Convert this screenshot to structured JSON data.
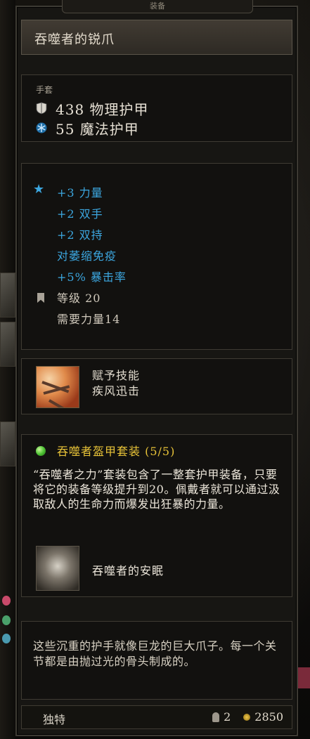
{
  "header": {
    "tab_label": "装备"
  },
  "item": {
    "name": "吞噬者的锐爪",
    "slot_type": "手套",
    "physical_armor": "438 物理护甲",
    "magic_armor": "55 魔法护甲"
  },
  "bonuses": {
    "lines": [
      "+3 力量",
      "+2 双手",
      "+2 双持",
      "对萎缩免疫",
      "+5% 暴击率"
    ],
    "level": "等级 20",
    "requirement": "需要力量14"
  },
  "skill": {
    "label": "赋予技能",
    "name": "疾风迅击"
  },
  "set": {
    "title": "吞噬者盔甲套装 (5/5)",
    "description": "“吞噬者之力”套装包含了一整套护甲装备，只要将它的装备等级提升到20。佩戴者就可以通过汲取敌人的生命力而爆发出狂暴的力量。",
    "item_name": "吞噬者的安眠"
  },
  "flavor_text": "这些沉重的护手就像巨龙的巨大爪子。每一个关节都是由抛过光的骨头制成的。",
  "footer": {
    "rarity": "独特",
    "count": "2",
    "price": "2850"
  },
  "colors": {
    "bonus_blue": "#3ca7e0",
    "set_gold": "#e8c338",
    "set_gem_green": "#4fc435"
  }
}
